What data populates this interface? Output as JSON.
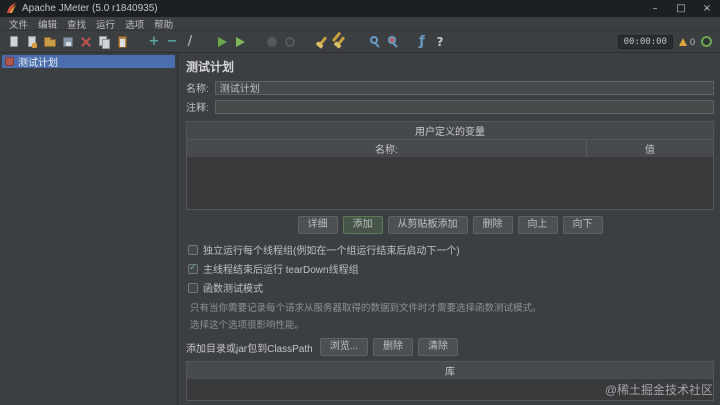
{
  "window": {
    "title": "Apache JMeter (5.0 r1840935)",
    "controls": {
      "minimize": "–",
      "maximize": "□",
      "close": "×"
    }
  },
  "menubar": {
    "items": [
      "文件",
      "编辑",
      "查找",
      "运行",
      "选项",
      "帮助"
    ]
  },
  "toolbar": {
    "icons": [
      {
        "name": "new-file",
        "glyph": ""
      },
      {
        "name": "templates",
        "glyph": ""
      },
      {
        "name": "open-file",
        "glyph": ""
      },
      {
        "name": "save",
        "glyph": ""
      },
      {
        "name": "cut",
        "glyph": ""
      },
      {
        "name": "copy",
        "glyph": ""
      },
      {
        "name": "paste",
        "glyph": ""
      },
      {
        "name": "expand-all",
        "glyph": "+"
      },
      {
        "name": "collapse-all",
        "glyph": "−"
      },
      {
        "name": "toggle",
        "glyph": "/"
      },
      {
        "name": "start",
        "glyph": ""
      },
      {
        "name": "start-no-pauses",
        "glyph": ""
      },
      {
        "name": "stop",
        "glyph": ""
      },
      {
        "name": "shutdown",
        "glyph": ""
      },
      {
        "name": "clear",
        "glyph": ""
      },
      {
        "name": "clear-all",
        "glyph": ""
      },
      {
        "name": "search",
        "glyph": ""
      },
      {
        "name": "search-reset",
        "glyph": ""
      },
      {
        "name": "function-helper",
        "glyph": "ƒ"
      },
      {
        "name": "help",
        "glyph": "?"
      }
    ],
    "timer": "00:00:00",
    "warning_count": "0"
  },
  "tree": {
    "items": [
      {
        "label": "测试计划",
        "selected": true
      }
    ]
  },
  "editor": {
    "title": "测试计划",
    "name_label": "名称:",
    "name_value": "测试计划",
    "comment_label": "注释:",
    "comment_value": "",
    "variables": {
      "title": "用户定义的变量",
      "columns": [
        "名称:",
        "值"
      ],
      "rows": []
    },
    "table_buttons": [
      "详细",
      "添加",
      "从剪贴板添加",
      "删除",
      "向上",
      "向下"
    ],
    "checkboxes": [
      {
        "label": "独立运行每个线程组(例如在一个组运行结束后启动下一个)",
        "checked": false,
        "mark": ""
      },
      {
        "label": "主线程结束后运行 tearDown线程组",
        "checked": true,
        "mark": "✓"
      },
      {
        "label": "函数测试模式",
        "checked": false,
        "mark": ""
      }
    ],
    "help_lines": [
      "只有当你需要记录每个请求从服务器取得的数据到文件时才需要选择函数测试模式。",
      "选择这个选项很影响性能。"
    ],
    "classpath": {
      "label": "添加目录或jar包到ClassPath",
      "buttons": [
        "浏览...",
        "删除",
        "清除"
      ],
      "column": "库"
    }
  },
  "watermark": "@稀土掘金技术社区"
}
